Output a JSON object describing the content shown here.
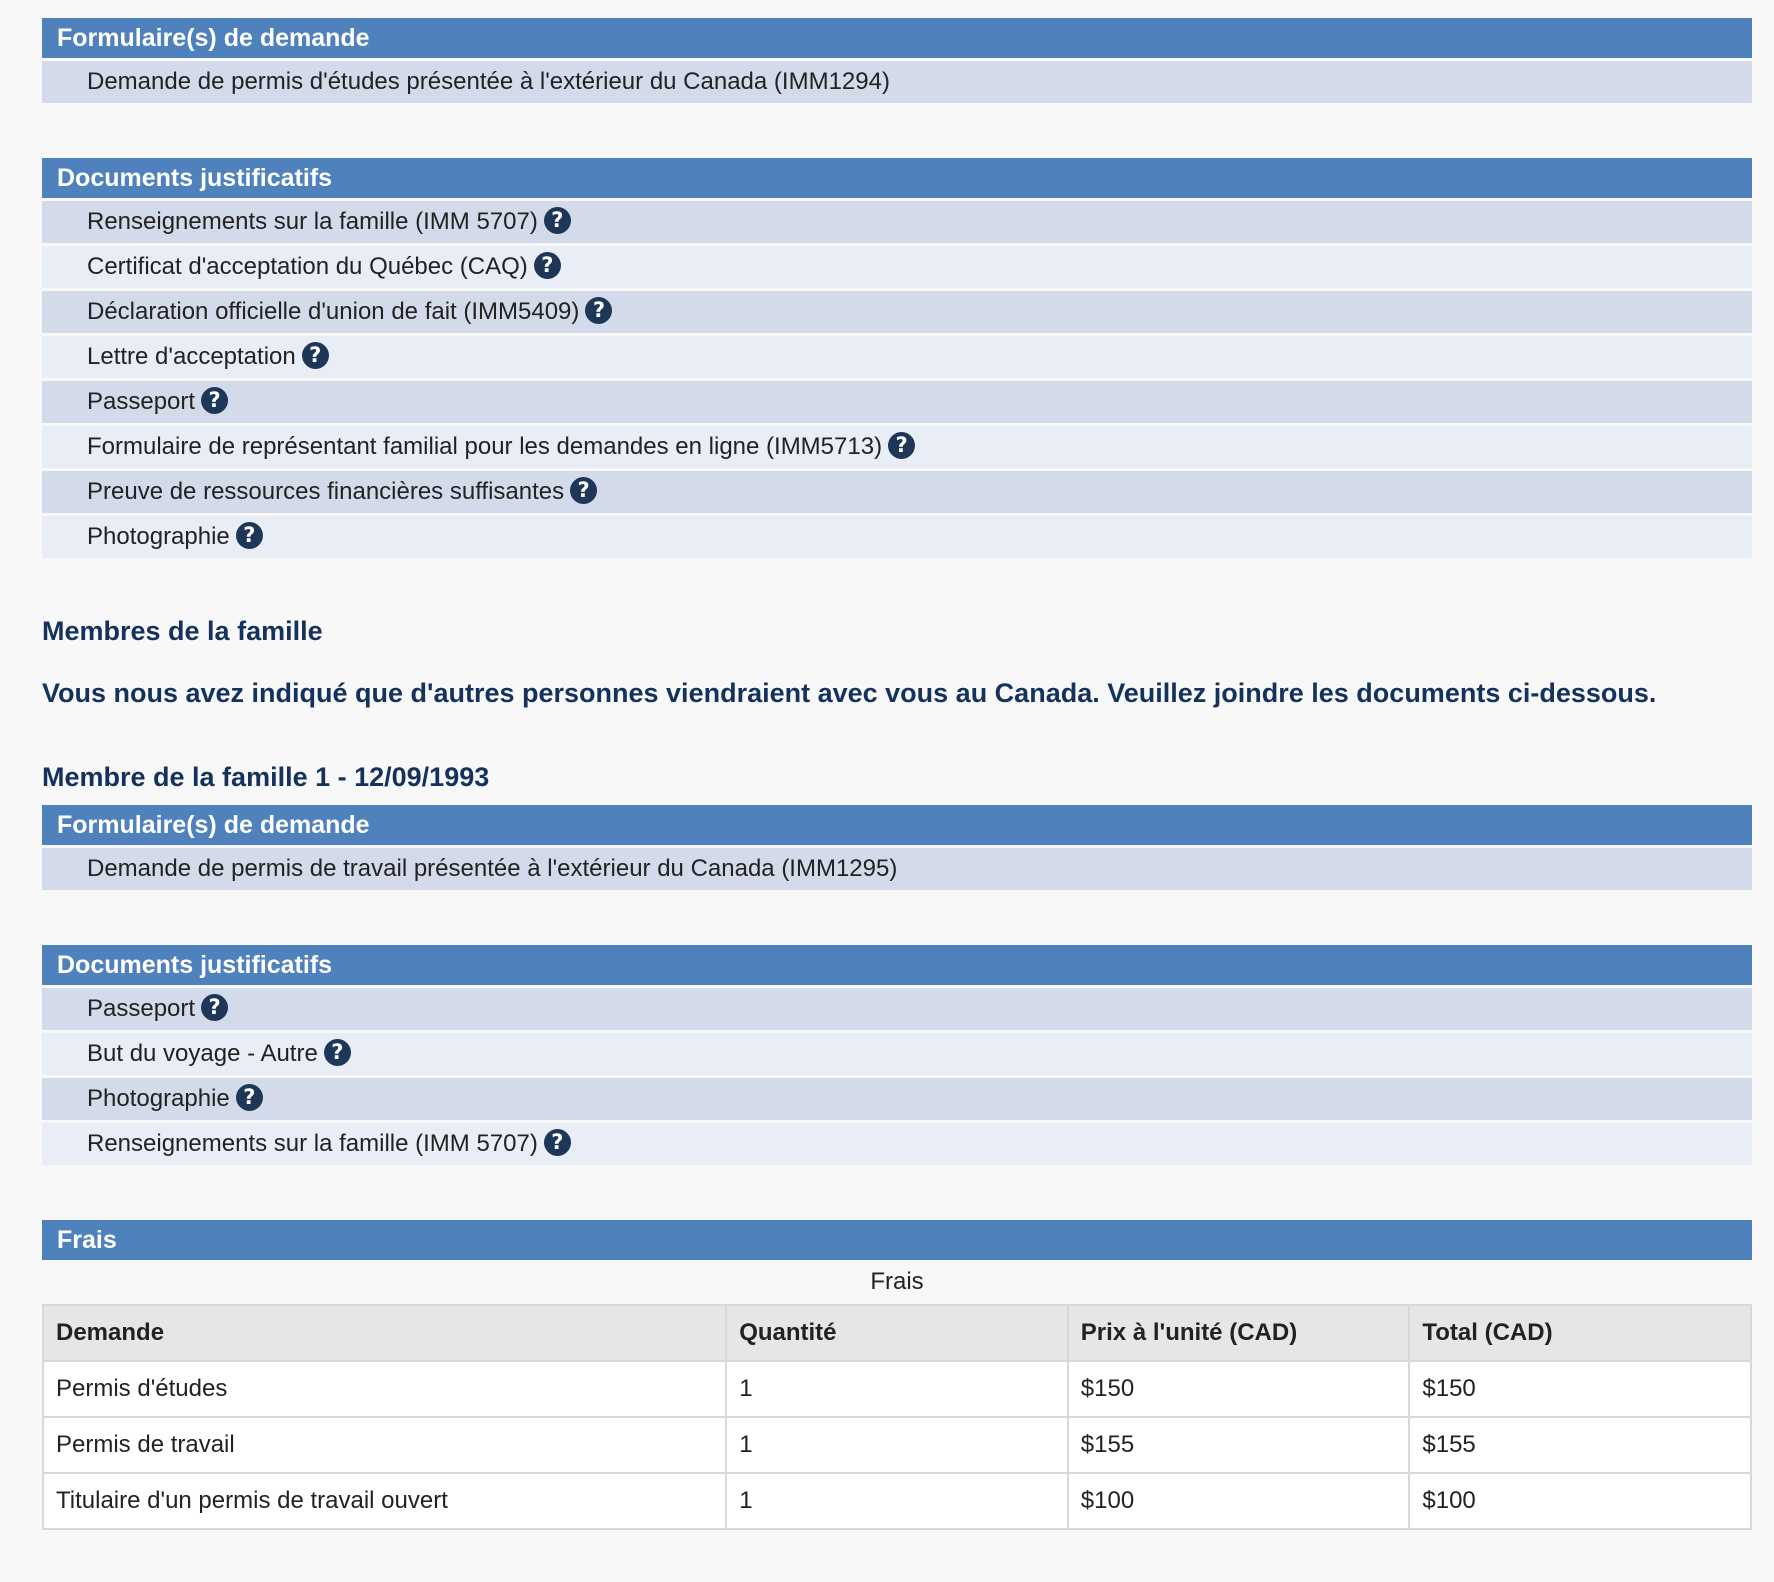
{
  "primary": {
    "forms_header": "Formulaire(s) de demande",
    "forms": [
      "Demande de permis d'études présentée à l'extérieur du Canada (IMM1294)"
    ],
    "docs_header": "Documents justificatifs",
    "documents": [
      "Renseignements sur la famille (IMM 5707)",
      "Certificat d'acceptation du Québec (CAQ)",
      "Déclaration officielle d'union de fait (IMM5409)",
      "Lettre d'acceptation",
      "Passeport",
      "Formulaire de représentant familial pour les demandes en ligne (IMM5713)",
      "Preuve de ressources financières suffisantes",
      "Photographie"
    ]
  },
  "family": {
    "title": "Membres de la famille",
    "notice": "Vous nous avez indiqué que d'autres personnes viendraient avec vous au Canada. Veuillez joindre les documents ci-dessous.",
    "member1": {
      "title": "Membre de la famille 1 - 12/09/1993",
      "forms_header": "Formulaire(s) de demande",
      "forms": [
        "Demande de permis de travail présentée à l'extérieur du Canada (IMM1295)"
      ],
      "docs_header": "Documents justificatifs",
      "documents": [
        "Passeport",
        "But du voyage - Autre",
        "Photographie",
        "Renseignements sur la famille (IMM 5707)"
      ]
    }
  },
  "fees": {
    "header": "Frais",
    "caption": "Frais",
    "columns": [
      "Demande",
      "Quantité",
      "Prix à l'unité (CAD)",
      "Total (CAD)"
    ],
    "rows": [
      [
        "Permis d'études",
        "1",
        "$150",
        "$150"
      ],
      [
        "Permis de travail",
        "1",
        "$155",
        "$155"
      ],
      [
        "Titulaire d'un permis de travail ouvert",
        "1",
        "$100",
        "$100"
      ]
    ]
  },
  "icons": {
    "help": "question-circle-icon",
    "help_glyph": "?"
  },
  "colors": {
    "header_bg": "#4f81bd",
    "row_odd": "#d3daea",
    "row_even": "#e8edf6",
    "heading_text": "#14325c",
    "icon_bg": "#1e3658"
  }
}
